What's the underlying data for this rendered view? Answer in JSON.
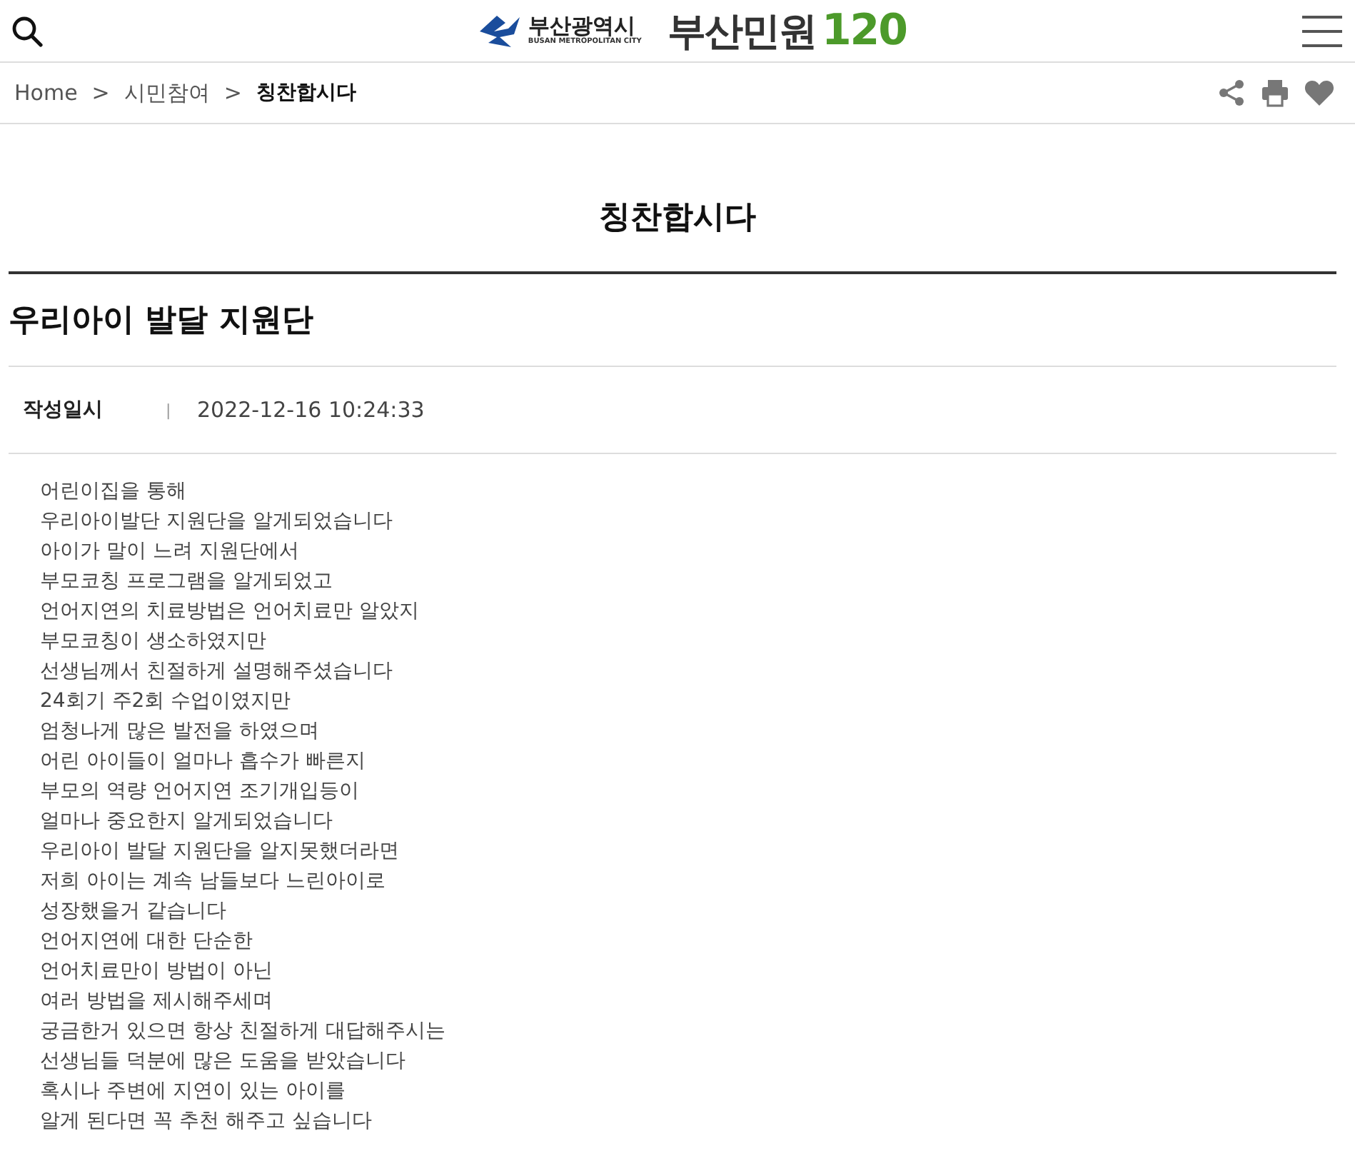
{
  "header": {
    "city_name": "부산광역시",
    "city_name_en": "BUSAN METROPOLITAN CITY",
    "service_name": "부산민원",
    "service_number": "120"
  },
  "breadcrumb": [
    {
      "label": "Home",
      "current": false
    },
    {
      "label": "시민참여",
      "current": false
    },
    {
      "label": "칭찬합시다",
      "current": true
    }
  ],
  "breadcrumb_separator": ">",
  "page_title": "칭찬합시다",
  "post": {
    "title": "우리아이 발달 지원단",
    "meta_label": "작성일시",
    "meta_separator": "|",
    "meta_value": "2022-12-16 10:24:33",
    "body_lines": [
      "어린이집을 통해",
      "우리아이발단 지원단을 알게되었습니다",
      "아이가 말이 느려 지원단에서",
      "부모코칭 프로그램을 알게되었고",
      "언어지연의 치료방법은 언어치료만 알았지",
      "부모코칭이 생소하였지만",
      "선생님께서 친절하게 설명해주셨습니다",
      "24회기 주2회 수업이였지만",
      "엄청나게 많은 발전을 하였으며",
      "어린 아이들이 얼마나 흡수가 빠른지",
      "부모의 역량 언어지연 조기개입등이",
      "얼마나 중요한지 알게되었습니다",
      "우리아이 발달 지원단을 알지못했더라면",
      "저희 아이는 계속 남들보다 느린아이로",
      "성장했을거 같습니다",
      "언어지연에 대한 단순한",
      "언어치료만이 방법이 아닌",
      "여러 방법을 제시해주세며",
      "궁금한거 있으면 항상 친절하게 대답해주시는",
      "선생님들 덕분에 많은 도움을 받았습니다",
      "혹시나 주변에 지연이 있는 아이를",
      "알게 된다면 꼭 추천 해주고 싶습니다"
    ]
  }
}
